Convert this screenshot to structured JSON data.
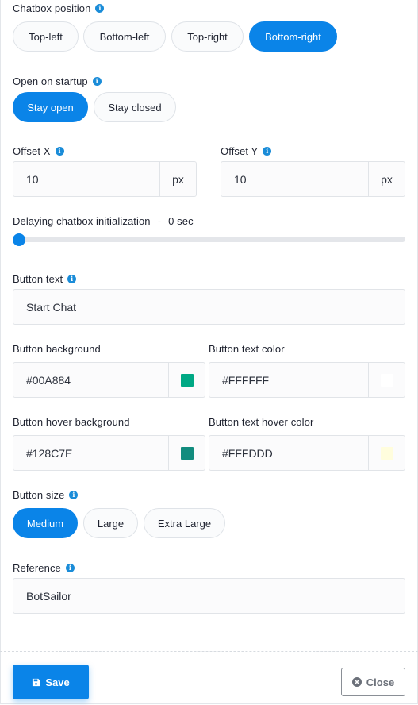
{
  "chatbox_position": {
    "label": "Chatbox position",
    "options": [
      "Top-left",
      "Bottom-left",
      "Top-right",
      "Bottom-right"
    ],
    "selected": "Bottom-right"
  },
  "open_on_startup": {
    "label": "Open on startup",
    "options": [
      "Stay open",
      "Stay closed"
    ],
    "selected": "Stay open"
  },
  "offset_x": {
    "label": "Offset X",
    "value": "10",
    "unit": "px"
  },
  "offset_y": {
    "label": "Offset Y",
    "value": "10",
    "unit": "px"
  },
  "delay": {
    "label": "Delaying chatbox initialization",
    "separator": "-",
    "value_text": "0 sec",
    "value": 0
  },
  "button_text": {
    "label": "Button text",
    "value": "Start Chat"
  },
  "button_background": {
    "label": "Button background",
    "value": "#00A884",
    "swatch": "#00A884"
  },
  "button_text_color": {
    "label": "Button text color",
    "value": "#FFFFFF",
    "swatch": "#FFFFFF"
  },
  "button_hover_background": {
    "label": "Button hover background",
    "value": "#128C7E",
    "swatch": "#128C7E"
  },
  "button_text_hover_color": {
    "label": "Button text hover color",
    "value": "#FFFDDD",
    "swatch": "#FFFDDD"
  },
  "button_size": {
    "label": "Button size",
    "options": [
      "Medium",
      "Large",
      "Extra Large"
    ],
    "selected": "Medium"
  },
  "reference": {
    "label": "Reference",
    "value": "BotSailor"
  },
  "footer": {
    "save_label": "Save",
    "close_label": "Close"
  },
  "colors": {
    "accent": "#0A84E8"
  }
}
